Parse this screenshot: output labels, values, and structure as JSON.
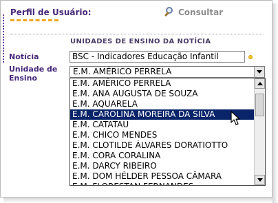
{
  "header": {
    "title": "Perfil de Usuário:",
    "consultar_label": "Consultar",
    "consultar_icon": "magnifier-icon"
  },
  "section": {
    "title": "UNIDADES DE ENSINO DA NOTÍCIA"
  },
  "form": {
    "noticia_label": "Notícia",
    "noticia_value": "BSC - Indicadores Educação Infantil",
    "unidade_label_line1": "Unidade de",
    "unidade_label_line2": "Ensino",
    "unidade_selected": "E.M. AMÉRICO PERRELA"
  },
  "dropdown": {
    "options": [
      "E.M. AMÉRICO PERRELA",
      "E.M. ANA AUGUSTA DE SOUZA",
      "E.M. AQUARELA",
      "E.M. CAROLINA MOREIRA DA SILVA",
      "E.M. CATATAU",
      "E.M. CHICO MENDES",
      "E.M. CLOTILDE ÁLVARES DORATIOTTO",
      "E.M. CORA CORALINA",
      "E.M. DARCY RIBEIRO",
      "E.M. DOM HÉLDER PESSOA CÂMARA",
      "E.M. FLORESTAN FERNANDES"
    ],
    "highlighted_index": 3
  },
  "colors": {
    "header_text": "#46287a",
    "underline": "#f0a51c",
    "highlight_bg": "#0a246a"
  }
}
